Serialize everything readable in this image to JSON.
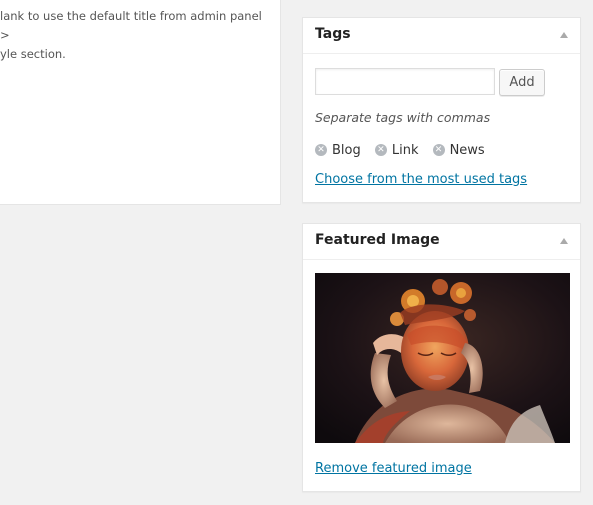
{
  "left_panel": {
    "note": "lank to use the default title from admin panel >\nyle section."
  },
  "tags_box": {
    "title": "Tags",
    "input_value": "",
    "add_button": "Add",
    "hint": "Separate tags with commas",
    "tags": [
      "Blog",
      "Link",
      "News"
    ],
    "most_used_link": "Choose from the most used tags"
  },
  "featured_image_box": {
    "title": "Featured Image",
    "image_icon": "featured-image",
    "remove_link": "Remove featured image"
  },
  "icons": {
    "toggle": "arrow-up-icon",
    "tag_remove": "remove-circle-icon"
  }
}
